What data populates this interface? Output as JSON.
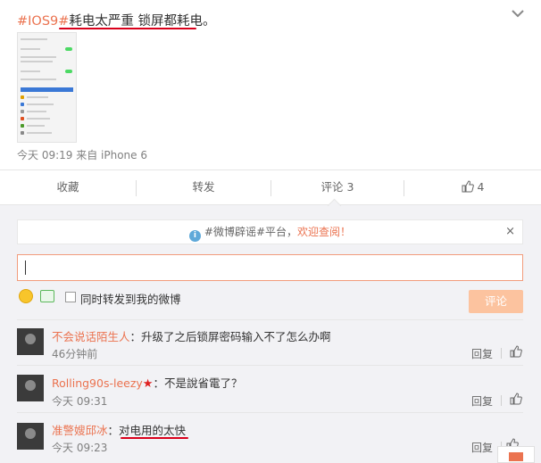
{
  "post": {
    "hashtag": "#IOS9#",
    "text": "耗电太严重 锁屏都耗电。",
    "meta": "今天 09:19 来自 iPhone 6"
  },
  "actions": {
    "favorite": "收藏",
    "repost": "转发",
    "comment_label": "评论",
    "comment_count": "3",
    "like_count": "4"
  },
  "notice": {
    "text_prefix": "#微博辟谣#平台，",
    "text_link": "欢迎查阅！",
    "close": "×"
  },
  "composer": {
    "input_value": "",
    "repost_option": "同时转发到我的微博",
    "submit": "评论"
  },
  "comments": [
    {
      "user": "不会说话陌生人",
      "text": "：升级了之后锁屏密码输入不了怎么办啊",
      "time": "46分钟前",
      "reply": "回复"
    },
    {
      "user": "Rolling90s-leezy",
      "badge": "★",
      "text": "：不是說省電了？",
      "time": "今天 09:31",
      "reply": "回复"
    },
    {
      "user": "准警嫂邱冰",
      "text": "：对电用的太快",
      "time": "今天 09:23",
      "reply": "回复"
    }
  ],
  "colors": {
    "accent": "#eb7350",
    "annotation_red": "#d9001b",
    "submit_disabled": "#fcc39f",
    "input_border": "#f29c7c"
  }
}
